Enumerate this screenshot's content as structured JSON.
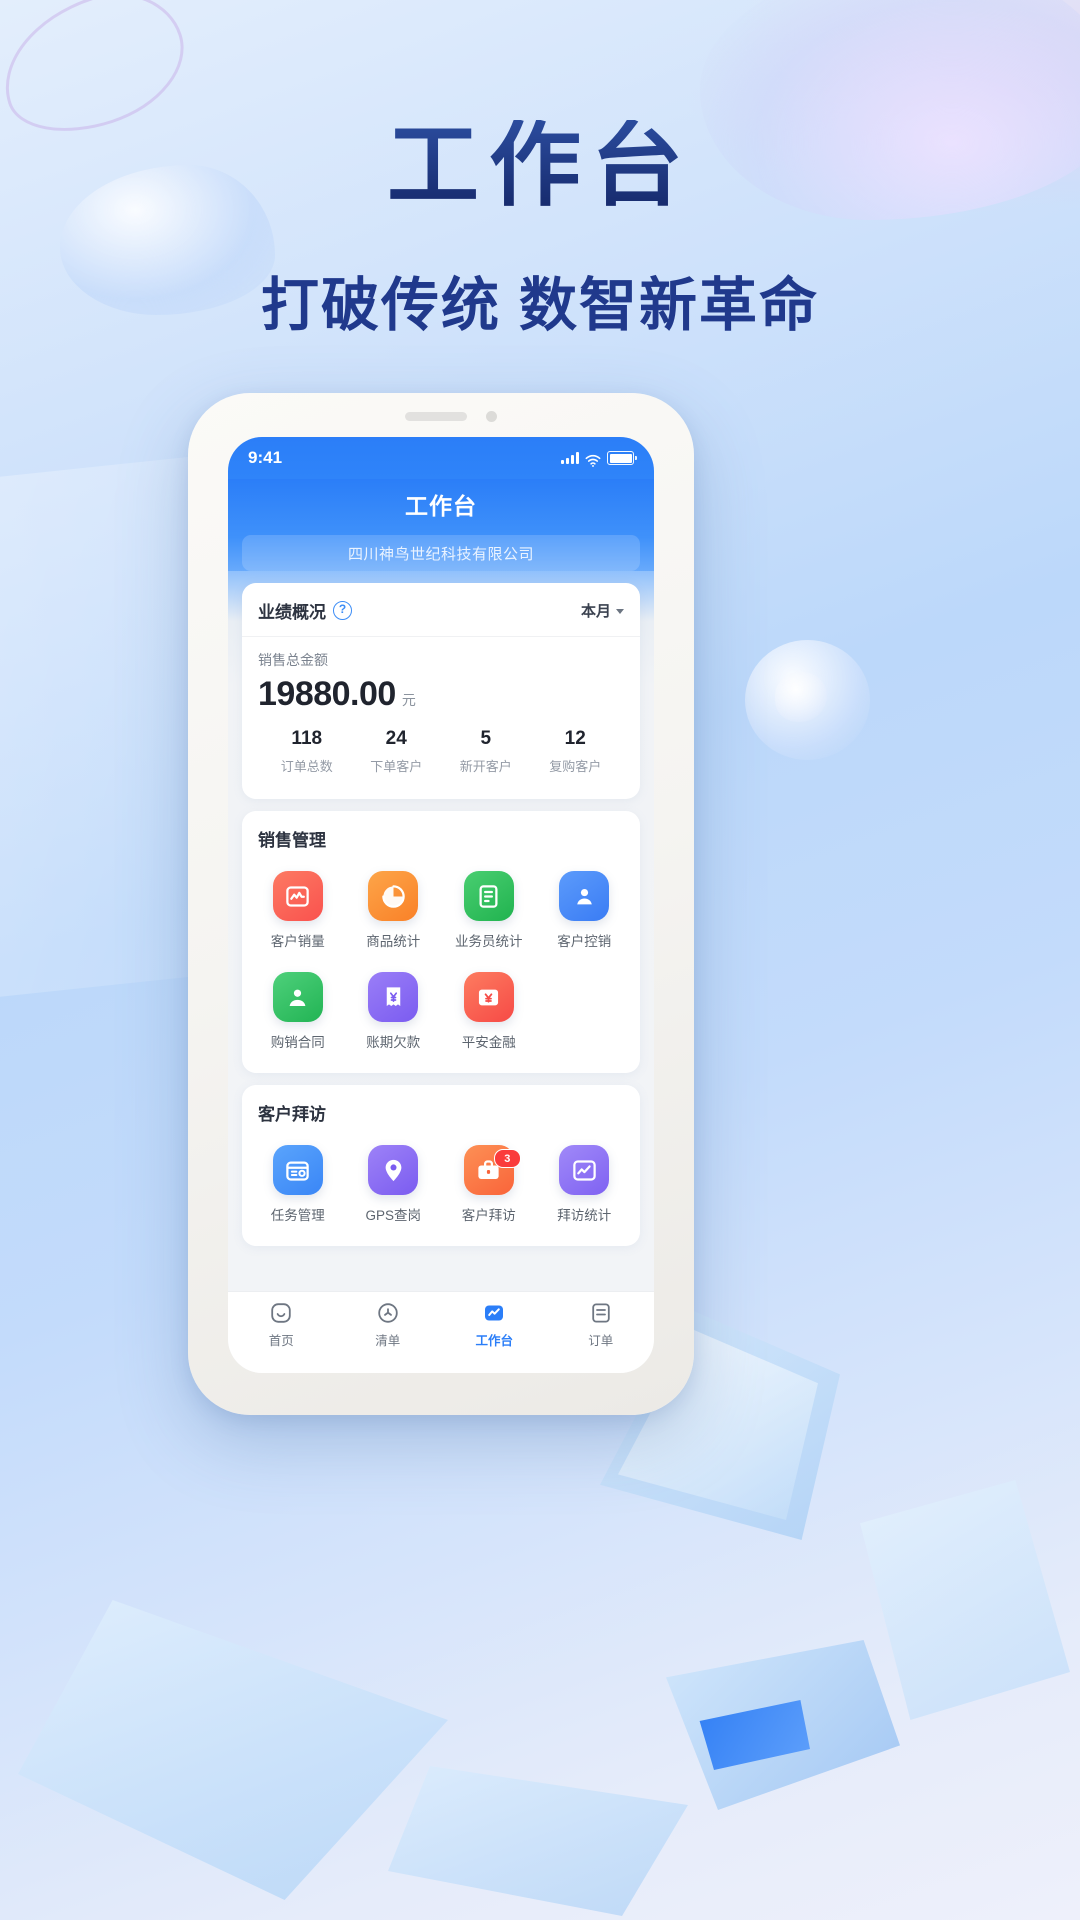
{
  "poster": {
    "title": "工作台",
    "subtitle": "打破传统 数智新革命",
    "title_color": "#1c3a85",
    "background_color": "#cfe2fb"
  },
  "phone": {
    "status_bar": {
      "time": "9:41",
      "signal_icon": "signal-bars-icon",
      "wifi_icon": "wifi-icon",
      "battery_icon": "battery-icon"
    },
    "header": {
      "title": "工作台",
      "company": "四川神鸟世纪科技有限公司",
      "accent_color": "#2b7ef8"
    },
    "performance_card": {
      "title": "业绩概况",
      "help_icon": "question-mark-icon",
      "period": "本月",
      "period_caret_icon": "chevron-down-icon",
      "amount_label": "销售总金额",
      "amount": "19880.00",
      "amount_unit": "元",
      "stats": [
        {
          "value": "118",
          "label": "订单总数"
        },
        {
          "value": "24",
          "label": "下单客户"
        },
        {
          "value": "5",
          "label": "新开客户"
        },
        {
          "value": "12",
          "label": "复购客户"
        }
      ]
    },
    "sales_section": {
      "title": "销售管理",
      "items": [
        {
          "label": "客户销量",
          "icon": "chart-pulse-icon",
          "color": "#f9524e",
          "color2": "#fd7a63"
        },
        {
          "label": "商品统计",
          "icon": "pie-chart-icon",
          "color": "#f98128",
          "color2": "#fda549"
        },
        {
          "label": "业务员统计",
          "icon": "document-chart-icon",
          "color": "#21b34f",
          "color2": "#49ce71"
        },
        {
          "label": "客户控销",
          "icon": "user-badge-icon",
          "color": "#3a7cf4",
          "color2": "#5c9bfb"
        },
        {
          "label": "购销合同",
          "icon": "contract-user-icon",
          "color": "#22b454",
          "color2": "#4ed07b"
        },
        {
          "label": "账期欠款",
          "icon": "receipt-yuan-icon",
          "color": "#7b5cf0",
          "color2": "#9a7ef7"
        },
        {
          "label": "平安金融",
          "icon": "finance-yuan-icon",
          "color": "#f64a46",
          "color2": "#fd7c60"
        }
      ]
    },
    "visit_section": {
      "title": "客户拜访",
      "items": [
        {
          "label": "任务管理",
          "icon": "task-calendar-icon",
          "color": "#3a86f6",
          "color2": "#5aa4fc",
          "badge": ""
        },
        {
          "label": "GPS查岗",
          "icon": "location-pin-icon",
          "color": "#7b5cf0",
          "color2": "#9d82f7",
          "badge": ""
        },
        {
          "label": "客户拜访",
          "icon": "briefcase-icon",
          "color": "#f9643a",
          "color2": "#fd9055",
          "badge": "3"
        },
        {
          "label": "拜访统计",
          "icon": "trend-chart-icon",
          "color": "#7f62f2",
          "color2": "#a089f8",
          "badge": ""
        }
      ]
    },
    "tabbar": {
      "items": [
        {
          "label": "首页",
          "icon": "home-smile-icon",
          "active": false
        },
        {
          "label": "清单",
          "icon": "share-nodes-icon",
          "active": false
        },
        {
          "label": "工作台",
          "icon": "workbench-icon",
          "active": true
        },
        {
          "label": "订单",
          "icon": "order-list-icon",
          "active": false
        }
      ],
      "active_color": "#2b7ef8"
    }
  }
}
